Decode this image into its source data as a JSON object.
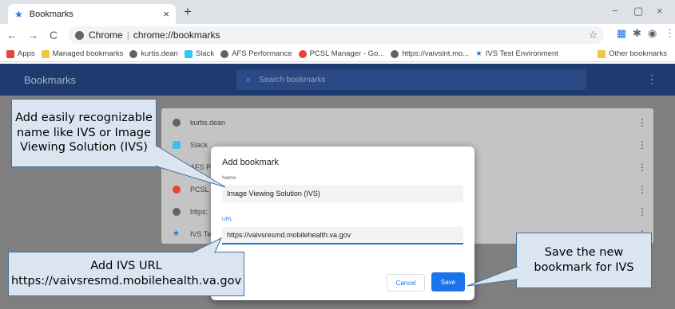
{
  "tab": {
    "title": "Bookmarks",
    "close": "×",
    "new_tab": "+"
  },
  "window": {
    "minimize": "−",
    "maximize": "▢",
    "close": "×"
  },
  "toolbar": {
    "back": "←",
    "forward": "→",
    "reload": "C",
    "site_label": "Chrome",
    "url": "chrome://bookmarks"
  },
  "bookmarks_bar": {
    "items": [
      "Apps",
      "Managed bookmarks",
      "kurtis.dean",
      "Slack",
      "AFS Performance",
      "PCSL Manager - Go...",
      "https://vaivsint.mo...",
      "IVS Test Environment"
    ],
    "other": "Other bookmarks"
  },
  "page": {
    "title": "Bookmarks",
    "search_placeholder": "Search bookmarks"
  },
  "list": {
    "rows": [
      "kurtis.dean",
      "Slack",
      "AFS P",
      "PCSL",
      "https:",
      "IVS Te"
    ]
  },
  "dialog": {
    "title": "Add bookmark",
    "name_label": "Name",
    "name_value": "Image Viewing Solution (IVS)",
    "url_label": "URL",
    "url_value": "https://vaivsresmd.mobilehealth.va.gov",
    "cancel_label": "Cancel",
    "save_label": "Save"
  },
  "callouts": {
    "name_hint": "Add easily recognizable name like IVS or Image Viewing Solution (IVS)",
    "url_hint_line1": "Add IVS URL",
    "url_hint_line2": "https://vaivsresmd.mobilehealth.va.gov",
    "save_hint": "Save the new bookmark for IVS"
  },
  "colors": {
    "header_bg": "#1e3a6e",
    "accent": "#1a73e8",
    "callout_bg": "#dbe5f1",
    "callout_border": "#41719c",
    "overlay": "#7f7f7f"
  }
}
